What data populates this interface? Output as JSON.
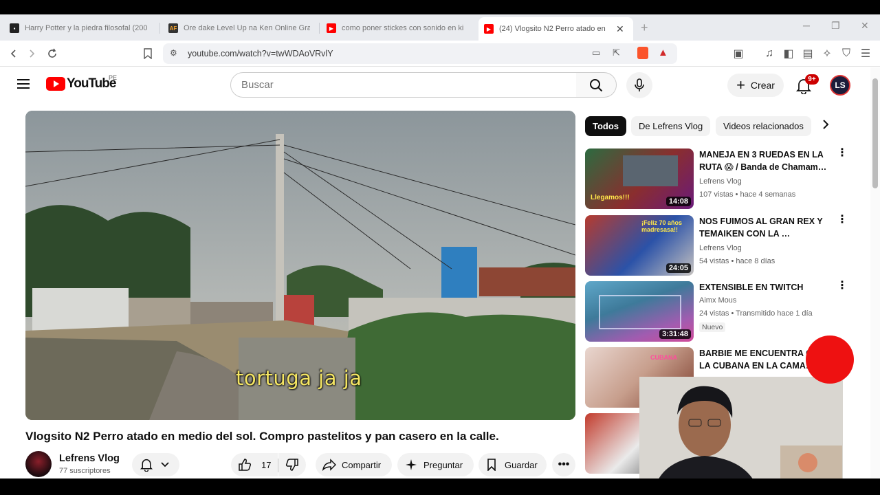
{
  "browser": {
    "tabs": [
      {
        "title": "Harry Potter y la piedra filosofal (200",
        "favicon": "film-icon",
        "color": "#222222"
      },
      {
        "title": "Ore dake Level Up na Ken Online Gra",
        "favicon": "af-icon",
        "color": "#e0892a"
      },
      {
        "title": "como poner stickes con sonido en ki",
        "favicon": "youtube-icon",
        "color": "#ff0000"
      },
      {
        "title": "(24) Vlogsito N2 Perro atado en",
        "favicon": "youtube-icon",
        "color": "#ff0000",
        "active": true
      }
    ],
    "url": "youtube.com/watch?v=twWDAoVRvlY"
  },
  "header": {
    "logo": "YouTube",
    "region": "PE",
    "search_placeholder": "Buscar",
    "create_label": "Crear",
    "notifications_badge": "9+",
    "avatar_initials": "LS"
  },
  "video": {
    "caption": "tortuga ja ja",
    "title": "Vlogsito N2 Perro atado en medio del sol. Compro pastelitos y pan casero en la calle.",
    "channel": "Lefrens Vlog",
    "subscribers": "77 suscriptores",
    "likes": "17",
    "share_label": "Compartir",
    "ask_label": "Preguntar",
    "save_label": "Guardar"
  },
  "filters": [
    "Todos",
    "De Lefrens Vlog",
    "Videos relacionados"
  ],
  "recommendations": [
    {
      "title": "MANEJA EN 3 RUEDAS EN LA RUTA 😱 / Banda de Chamam…",
      "channel": "Lefrens Vlog",
      "meta": "107 vistas • hace 4 semanas",
      "duration": "14:08",
      "thumb_text": "Llegamos!!!"
    },
    {
      "title": "NOS FUIMOS AL GRAN REX Y TEMAIKEN CON LA …",
      "channel": "Lefrens Vlog",
      "meta": "54 vistas • hace 8 días",
      "duration": "24:05",
      "thumb_text": "¡Feliz 70 años madresasa!!"
    },
    {
      "title": "EXTENSIBLE EN TWITCH",
      "channel": "Aimx Mous",
      "meta": "24 vistas • Transmitido hace 1 día",
      "duration": "3:31:48",
      "badge": "Nuevo"
    },
    {
      "title": "BARBIE ME ENCUENTRA C… LA CUBANA EN LA CAMA…",
      "thumb_text": "CUBANA"
    }
  ]
}
